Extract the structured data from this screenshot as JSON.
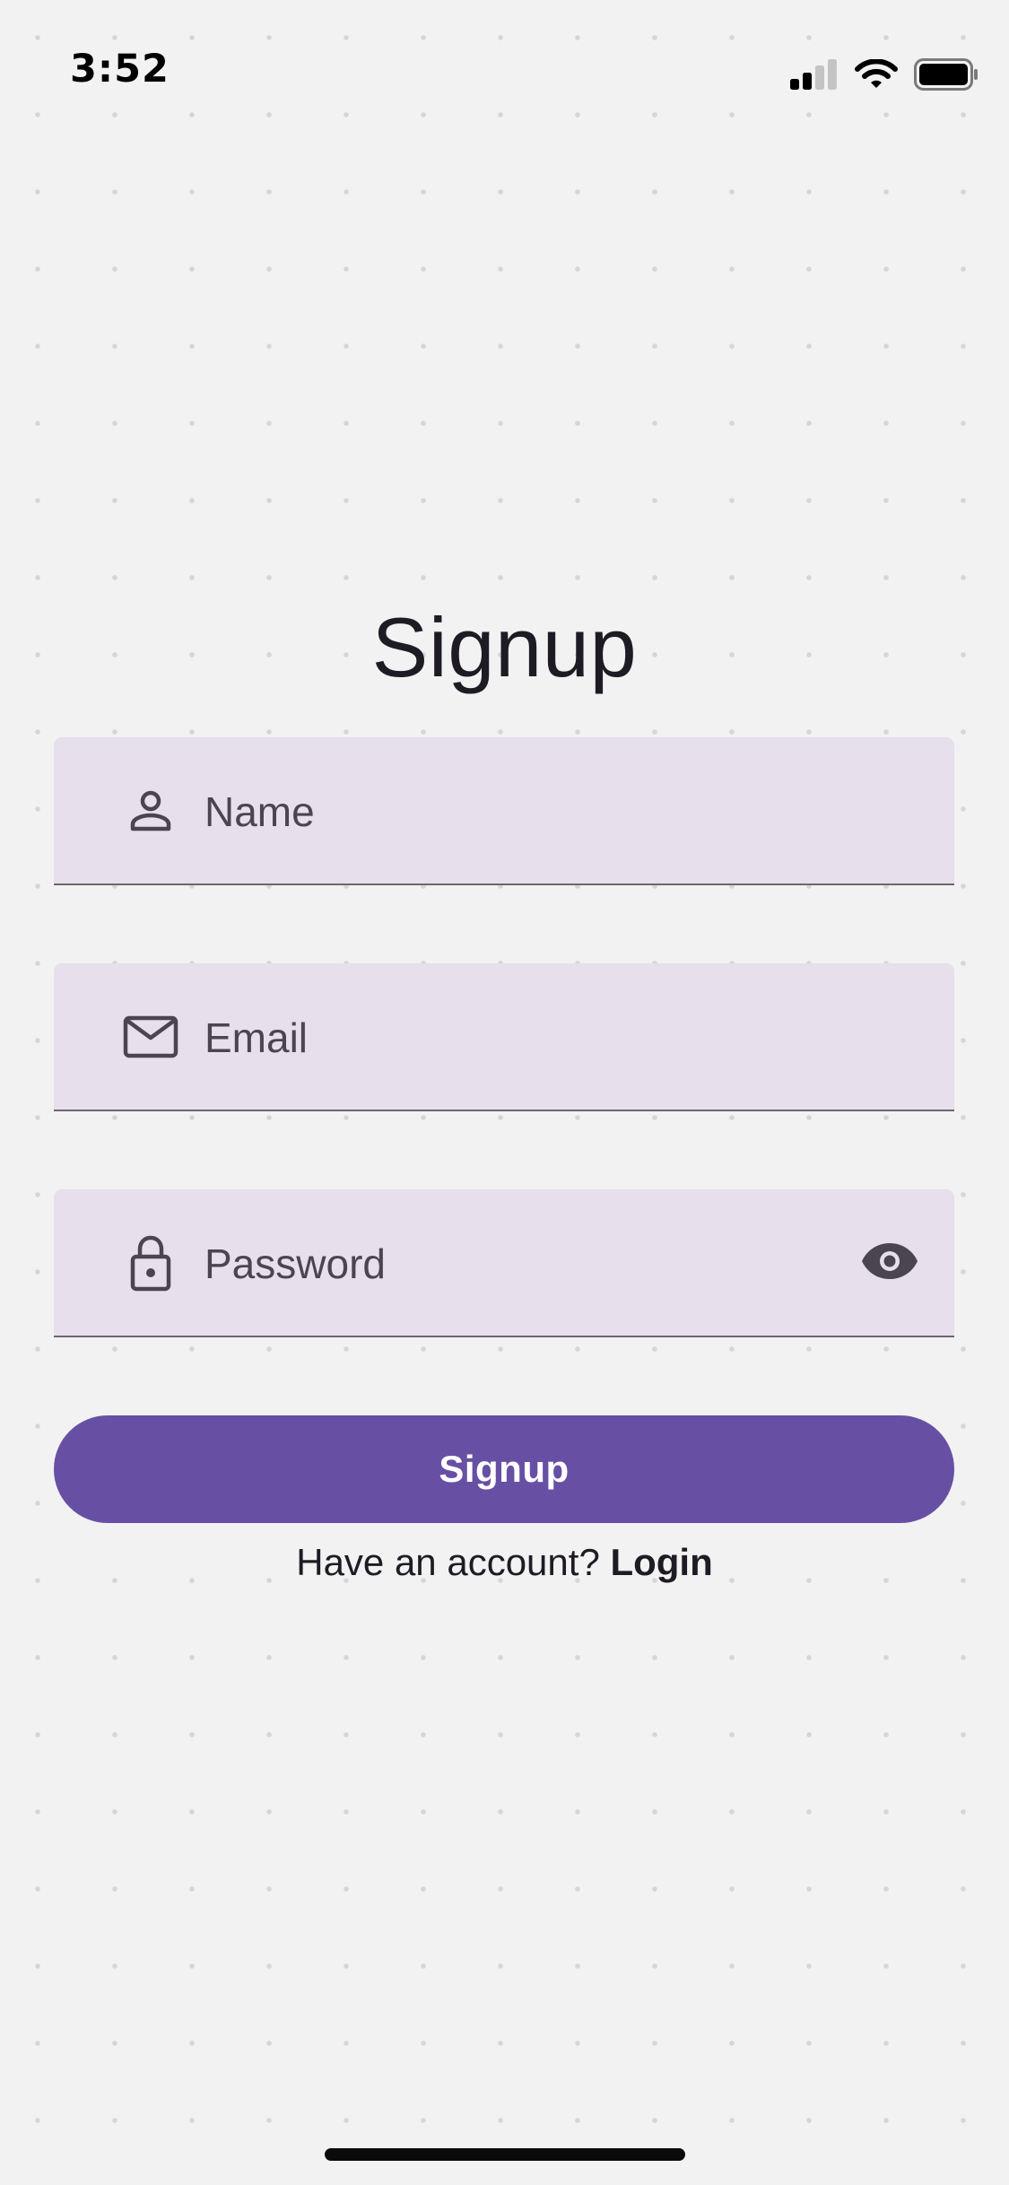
{
  "status_bar": {
    "time": "3:52",
    "icons": [
      "cellular-signal-icon",
      "wifi-icon",
      "battery-icon"
    ]
  },
  "title": "Signup",
  "form": {
    "name": {
      "placeholder": "Name",
      "value": "",
      "icon": "person-icon"
    },
    "email": {
      "placeholder": "Email",
      "value": "",
      "icon": "envelope-icon"
    },
    "password": {
      "placeholder": "Password",
      "value": "",
      "icon": "lock-icon",
      "toggle_icon": "eye-icon"
    },
    "submit_label": "Signup"
  },
  "footer": {
    "prompt": "Have an account?",
    "link_label": "Login"
  },
  "colors": {
    "background": "#f2f2f2",
    "field_fill": "#e7dfec",
    "accent": "#6750a4",
    "text": "#1f1b24",
    "icon": "#4b4551"
  }
}
